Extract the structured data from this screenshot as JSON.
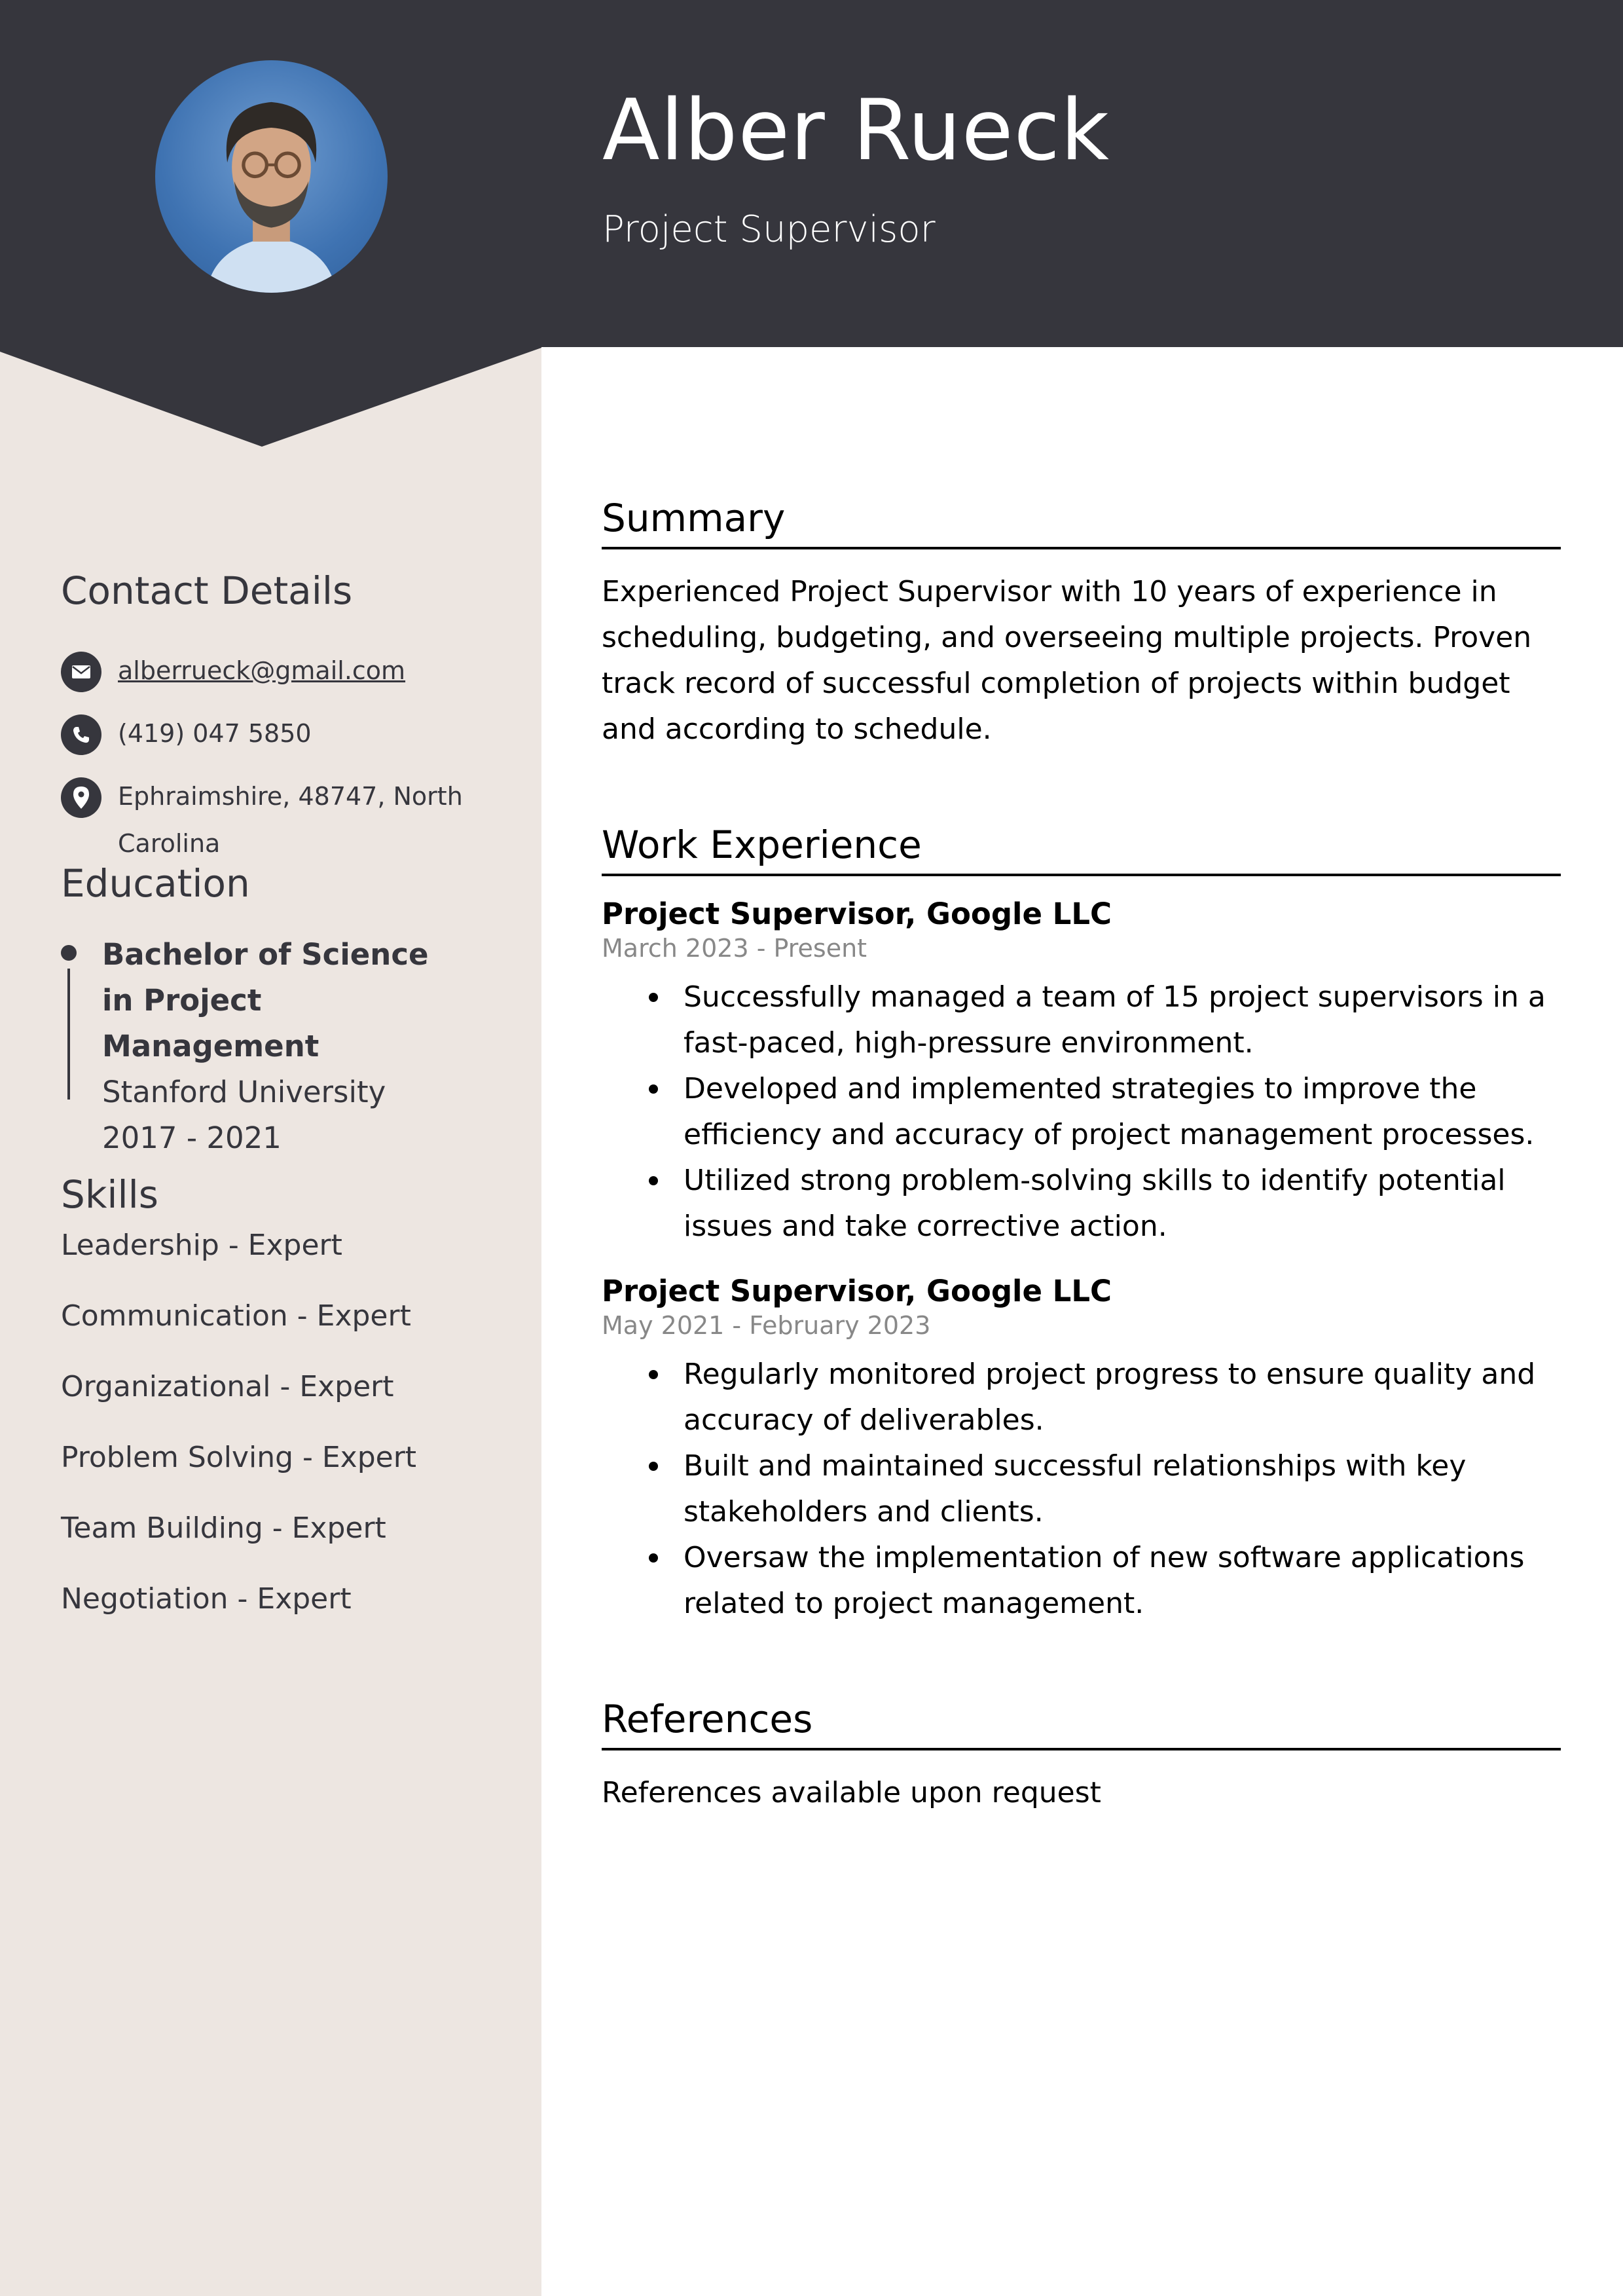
{
  "header": {
    "name": "Alber Rueck",
    "title": "Project Supervisor",
    "photo": "profile-photo"
  },
  "colors": {
    "header_bg": "#36363d",
    "sidebar_bg": "#ede6e1",
    "text_dark": "#36363d",
    "date_gray": "#888888"
  },
  "sidebar": {
    "contact": {
      "heading": "Contact Details",
      "email": "alberrueck@gmail.com",
      "phone": "(419) 047 5850",
      "address": "Ephraimshire, 48747, North Carolina",
      "icons": [
        "envelope-icon",
        "phone-icon",
        "location-pin-icon"
      ]
    },
    "education": {
      "heading": "Education",
      "entries": [
        {
          "degree": "Bachelor of Science in Project Management",
          "school": "Stanford University",
          "years": "2017 - 2021"
        }
      ]
    },
    "skills": {
      "heading": "Skills",
      "items": [
        "Leadership - Expert",
        "Communication - Expert",
        "Organizational - Expert",
        "Problem Solving - Expert",
        "Team Building - Expert",
        "Negotiation - Expert"
      ]
    }
  },
  "main": {
    "summary": {
      "heading": "Summary",
      "text": "Experienced Project Supervisor with 10 years of experience in scheduling, budgeting, and overseeing multiple projects. Proven track record of successful completion of projects within budget and according to schedule."
    },
    "work": {
      "heading": "Work Experience",
      "jobs": [
        {
          "title": "Project Supervisor, Google LLC",
          "dates": "March 2023 - Present",
          "bullets": [
            "Successfully managed a team of 15 project supervisors in a fast-paced, high-pressure environment.",
            "Developed and implemented strategies to improve the efficiency and accuracy of project management processes.",
            "Utilized strong problem-solving skills to identify potential issues and take corrective action."
          ]
        },
        {
          "title": "Project Supervisor, Google LLC",
          "dates": "May 2021 - February 2023",
          "bullets": [
            "Regularly monitored project progress to ensure quality and accuracy of deliverables.",
            "Built and maintained successful relationships with key stakeholders and clients.",
            "Oversaw the implementation of new software applications related to project management."
          ]
        }
      ]
    },
    "references": {
      "heading": "References",
      "text": "References available upon request"
    }
  }
}
